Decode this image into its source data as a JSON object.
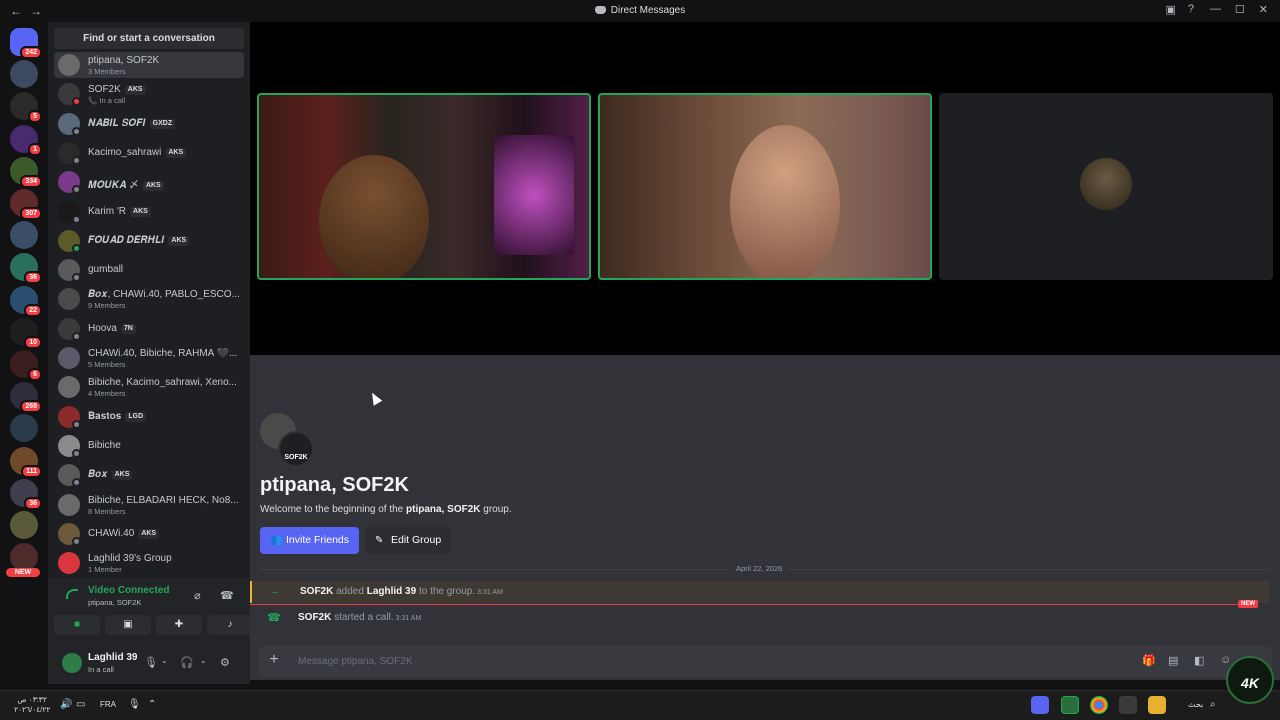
{
  "titlebar": {
    "title": "Direct Messages",
    "back": "←",
    "forward": "→",
    "inbox_icon": "▣",
    "help_icon": "?",
    "min": "—",
    "max": "☐",
    "close": "✕"
  },
  "servers": [
    {
      "color": "#5865f2",
      "badge": "242",
      "icon": "discord-home-icon"
    },
    {
      "color": "#3b4a5e",
      "badge": "",
      "icon": "server-icon"
    },
    {
      "color": "#2a2a2a",
      "badge": "5",
      "icon": "server-icon"
    },
    {
      "color": "#4a2a6e",
      "badge": "1",
      "icon": "server-icon"
    },
    {
      "color": "#3a5a2a",
      "badge": "334",
      "icon": "server-icon"
    },
    {
      "color": "#5e2a2a",
      "badge": "307",
      "icon": "server-icon"
    },
    {
      "color": "#3a4e66",
      "badge": "",
      "icon": "server-icon"
    },
    {
      "color": "#2a6e5e",
      "badge": "36",
      "icon": "server-icon"
    },
    {
      "color": "#2a4e6e",
      "badge": "22",
      "icon": "server-icon"
    },
    {
      "color": "#1e1e1e",
      "badge": "10",
      "icon": "server-icon"
    },
    {
      "color": "#3a1e1e",
      "badge": "6",
      "icon": "server-icon"
    },
    {
      "color": "#2e2e3e",
      "badge": "269",
      "icon": "server-icon"
    },
    {
      "color": "#2a3a4a",
      "badge": "",
      "icon": "server-icon"
    },
    {
      "color": "#6e4a2a",
      "badge": "111",
      "icon": "server-icon"
    },
    {
      "color": "#3e3e4e",
      "badge": "36",
      "icon": "server-icon"
    },
    {
      "color": "#5a5a3a",
      "badge": "",
      "icon": "server-icon"
    },
    {
      "color": "#4e2a2a",
      "badge": "",
      "new": "NEW",
      "icon": "server-icon"
    }
  ],
  "search": {
    "placeholder": "Find or start a conversation"
  },
  "dms": [
    {
      "name": "ptipana, SOF2K",
      "sub": "3 Members",
      "active": true,
      "status": "",
      "av": "#6a6a6a",
      "tag": ""
    },
    {
      "name": "SOF2K",
      "sub": "📞 In a call",
      "status": "dnd",
      "av": "#3a3a3a",
      "tag": "AKS"
    },
    {
      "name": "𝑵𝑨𝑩𝑰𝑳 𝑺𝑶𝑭𝑰",
      "sub": "",
      "status": "",
      "av": "#5a6a7a",
      "tag": "GXDZ"
    },
    {
      "name": "Kacimo_sahrawi",
      "sub": "",
      "status": "",
      "av": "#2a2a2a",
      "tag": "AKS"
    },
    {
      "name": "𝑴𝑶𝑼𝑲𝑨 〆",
      "sub": "",
      "status": "",
      "av": "#7a3a8a",
      "tag": "AKS"
    },
    {
      "name": "Karim 'R",
      "sub": "",
      "status": "",
      "av": "#1a1a1a",
      "tag": "AKS"
    },
    {
      "name": "𝑭𝑶𝑼𝑨𝑫 𝑫𝑬𝑹𝑯𝑳𝑰",
      "sub": "",
      "status": "on",
      "av": "#5a5a2a",
      "tag": "AKS"
    },
    {
      "name": "gumball",
      "sub": "",
      "status": "",
      "av": "#5a5a5a",
      "tag": ""
    },
    {
      "name": "𝑩𝒐𝒙, CHAWi.40, PABLO_ESCO...",
      "sub": "9 Members",
      "status": "",
      "av": "#4a4a4a",
      "tag": ""
    },
    {
      "name": "Hoova",
      "sub": "",
      "status": "",
      "av": "#3a3a3a",
      "tag": "7N"
    },
    {
      "name": "CHAWi.40, Bibiche, RAHMA 🖤...",
      "sub": "5 Members",
      "status": "",
      "av": "#5a5a6a",
      "tag": ""
    },
    {
      "name": "Bibiche, Kacimo_sahrawi, Xeno...",
      "sub": "4 Members",
      "status": "",
      "av": "#6a6a6a",
      "tag": ""
    },
    {
      "name": "𝐁𝐚𝐬𝐭𝐨𝐬",
      "sub": "",
      "status": "",
      "av": "#8a2a2a",
      "tag": "LGD"
    },
    {
      "name": "Bibiche",
      "sub": "",
      "status": "",
      "av": "#8a8a8a",
      "tag": ""
    },
    {
      "name": "𝑩𝒐𝒙",
      "sub": "",
      "status": "",
      "av": "#5a5a5a",
      "tag": "AKS"
    },
    {
      "name": "Bibiche, ELBADARI HECK, No8...",
      "sub": "8 Members",
      "status": "",
      "av": "#6a6a6a",
      "tag": ""
    },
    {
      "name": "CHAWi.40",
      "sub": "",
      "status": "",
      "av": "#6a5a3a",
      "tag": "AKS"
    },
    {
      "name": "Laghlid 39's Group",
      "sub": "1 Member",
      "status": "",
      "av": "#da373c",
      "tag": ""
    }
  ],
  "voice": {
    "status": "Video Connected",
    "channel": "ptipana, SOF2K"
  },
  "user": {
    "name": "Laghlid 39",
    "status": "In a call"
  },
  "group": {
    "name": "ptipana, SOF2K",
    "avatar_label": "SOF2K",
    "welcome_prefix": "Welcome to the beginning of the ",
    "welcome_bold": "ptipana, SOF2K",
    "welcome_suffix": " group.",
    "invite_label": "Invite Friends",
    "edit_label": "Edit Group"
  },
  "messages": {
    "date": "April 22, 2026",
    "m1": {
      "actor": "SOF2K",
      "action": " added ",
      "target": "Laghlid 39",
      "rest": " to the group.",
      "time": "3:31 AM"
    },
    "m2": {
      "actor": "SOF2K",
      "action": " started a call.",
      "time": "3:31 AM"
    },
    "new_badge": "NEW"
  },
  "composer": {
    "placeholder": "Message ptipana, SOF2K"
  },
  "taskbar": {
    "time": "٠٣:٣٢ ص",
    "date": "٢٠٢٦/٠٤/٢٢",
    "lang": "FRA",
    "search": "بحث"
  },
  "logo": "4K"
}
